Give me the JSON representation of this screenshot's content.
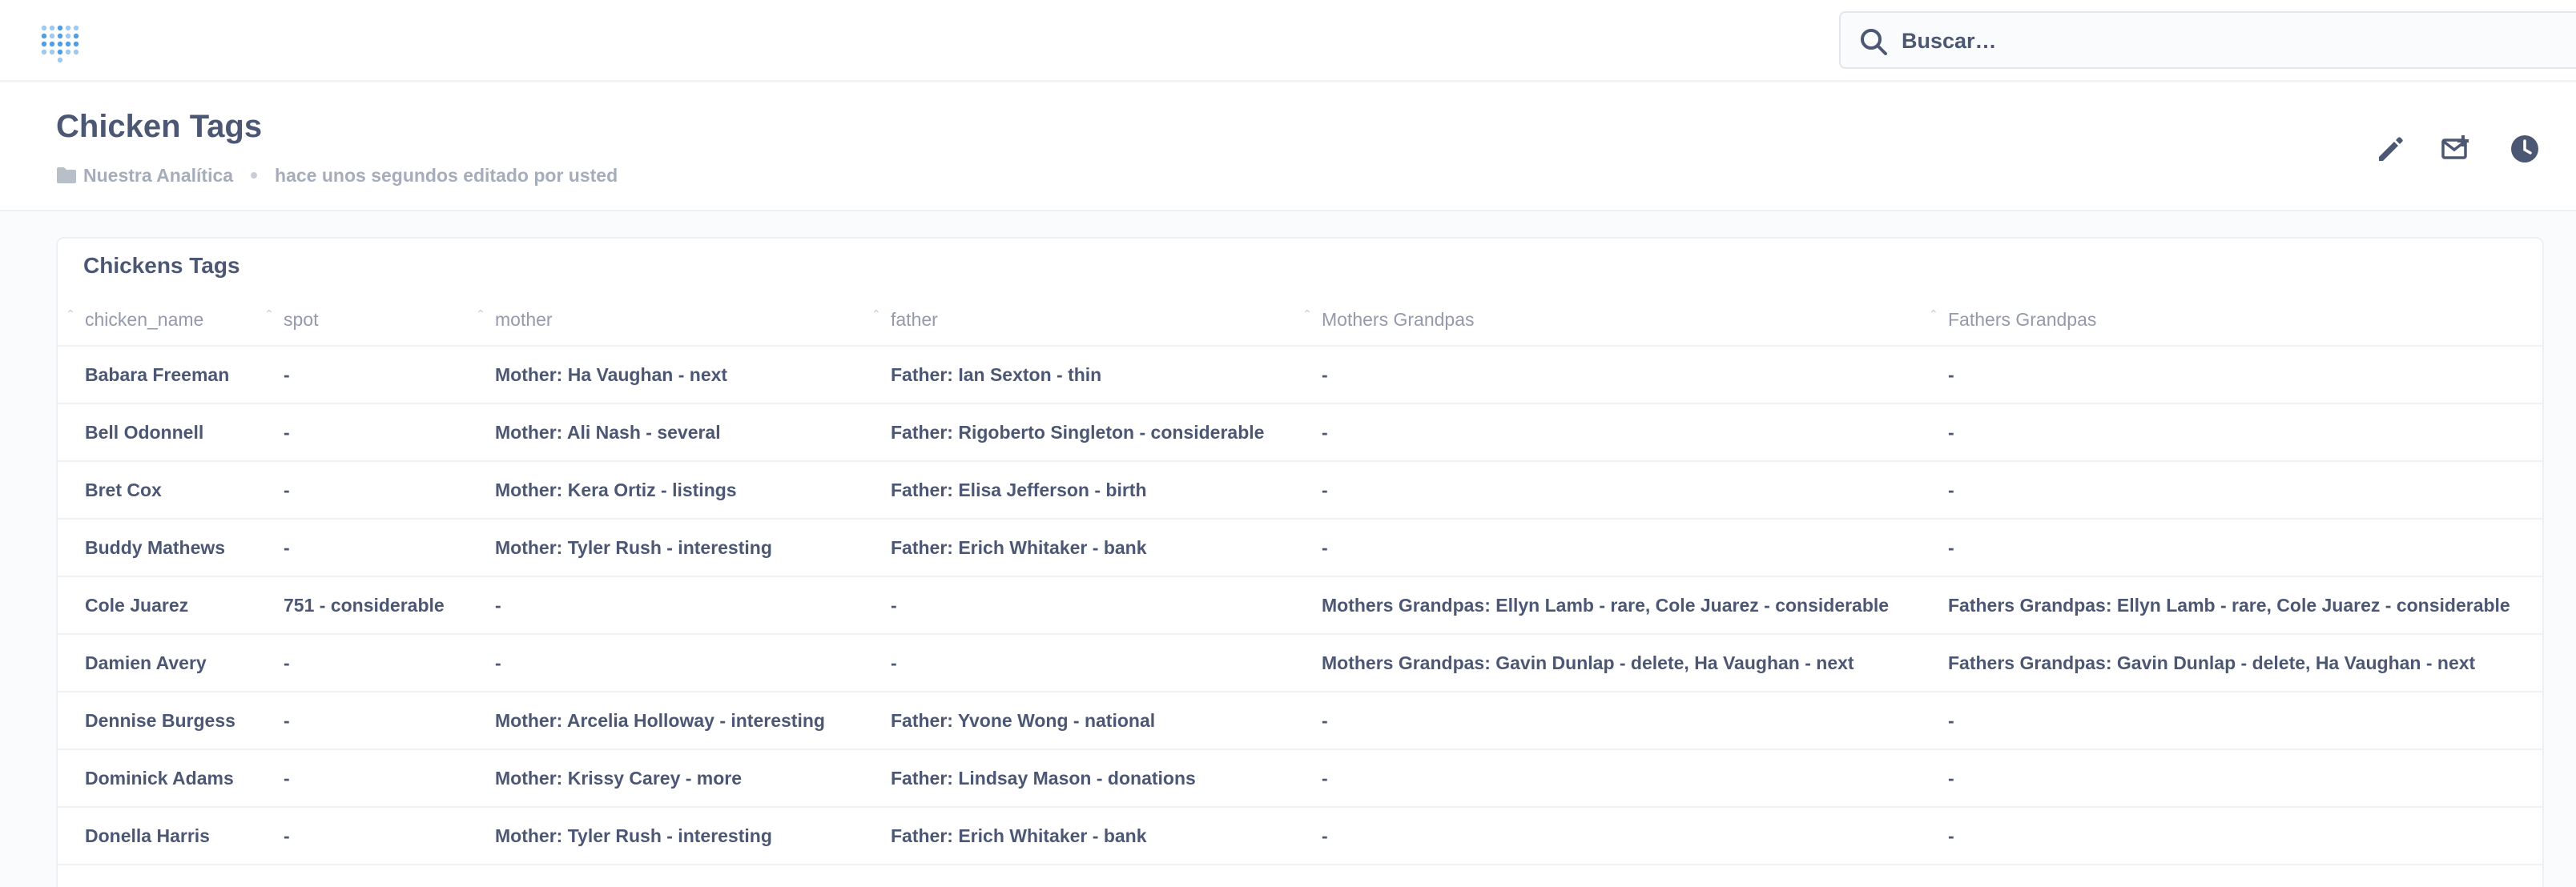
{
  "nav": {
    "search_placeholder": "Buscar…"
  },
  "header": {
    "title": "Chicken Tags",
    "collection": "Nuestra Analítica",
    "edited": "hace unos segundos editado por usted"
  },
  "card": {
    "title": "Chickens Tags",
    "columns": [
      "chicken_name",
      "spot",
      "mother",
      "father",
      "Mothers Grandpas",
      "Fathers Grandpas"
    ],
    "rows": [
      [
        "Babara Freeman",
        "-",
        "Mother: Ha Vaughan - next",
        "Father: Ian Sexton - thin",
        "-",
        "-"
      ],
      [
        "Bell Odonnell",
        "-",
        "Mother: Ali Nash - several",
        "Father: Rigoberto Singleton - considerable",
        "-",
        "-"
      ],
      [
        "Bret Cox",
        "-",
        "Mother: Kera Ortiz - listings",
        "Father: Elisa Jefferson - birth",
        "-",
        "-"
      ],
      [
        "Buddy Mathews",
        "-",
        "Mother: Tyler Rush - interesting",
        "Father: Erich Whitaker - bank",
        "-",
        "-"
      ],
      [
        "Cole Juarez",
        "751 - considerable",
        "-",
        "-",
        "Mothers Grandpas: Ellyn Lamb - rare, Cole Juarez - considerable",
        "Fathers Grandpas: Ellyn Lamb - rare, Cole Juarez - considerable"
      ],
      [
        "Damien Avery",
        "-",
        "-",
        "-",
        "Mothers Grandpas: Gavin Dunlap - delete, Ha Vaughan - next",
        "Fathers Grandpas: Gavin Dunlap - delete, Ha Vaughan - next"
      ],
      [
        "Dennise Burgess",
        "-",
        "Mother: Arcelia Holloway - interesting",
        "Father: Yvone Wong - national",
        "-",
        "-"
      ],
      [
        "Dominick Adams",
        "-",
        "Mother: Krissy Carey - more",
        "Father: Lindsay Mason - donations",
        "-",
        "-"
      ],
      [
        "Donella Harris",
        "-",
        "Mother: Tyler Rush - interesting",
        "Father: Erich Whitaker - bank",
        "-",
        "-"
      ]
    ]
  },
  "icons": {
    "logo": "metabase-logo-icon",
    "search": "search-icon",
    "folder": "folder-icon",
    "edit": "pencil-icon",
    "subscribe": "mail-plus-icon",
    "history": "clock-icon"
  },
  "colors": {
    "accent": "#509ee3",
    "text": "#4c5773",
    "muted": "#a5adbb"
  }
}
